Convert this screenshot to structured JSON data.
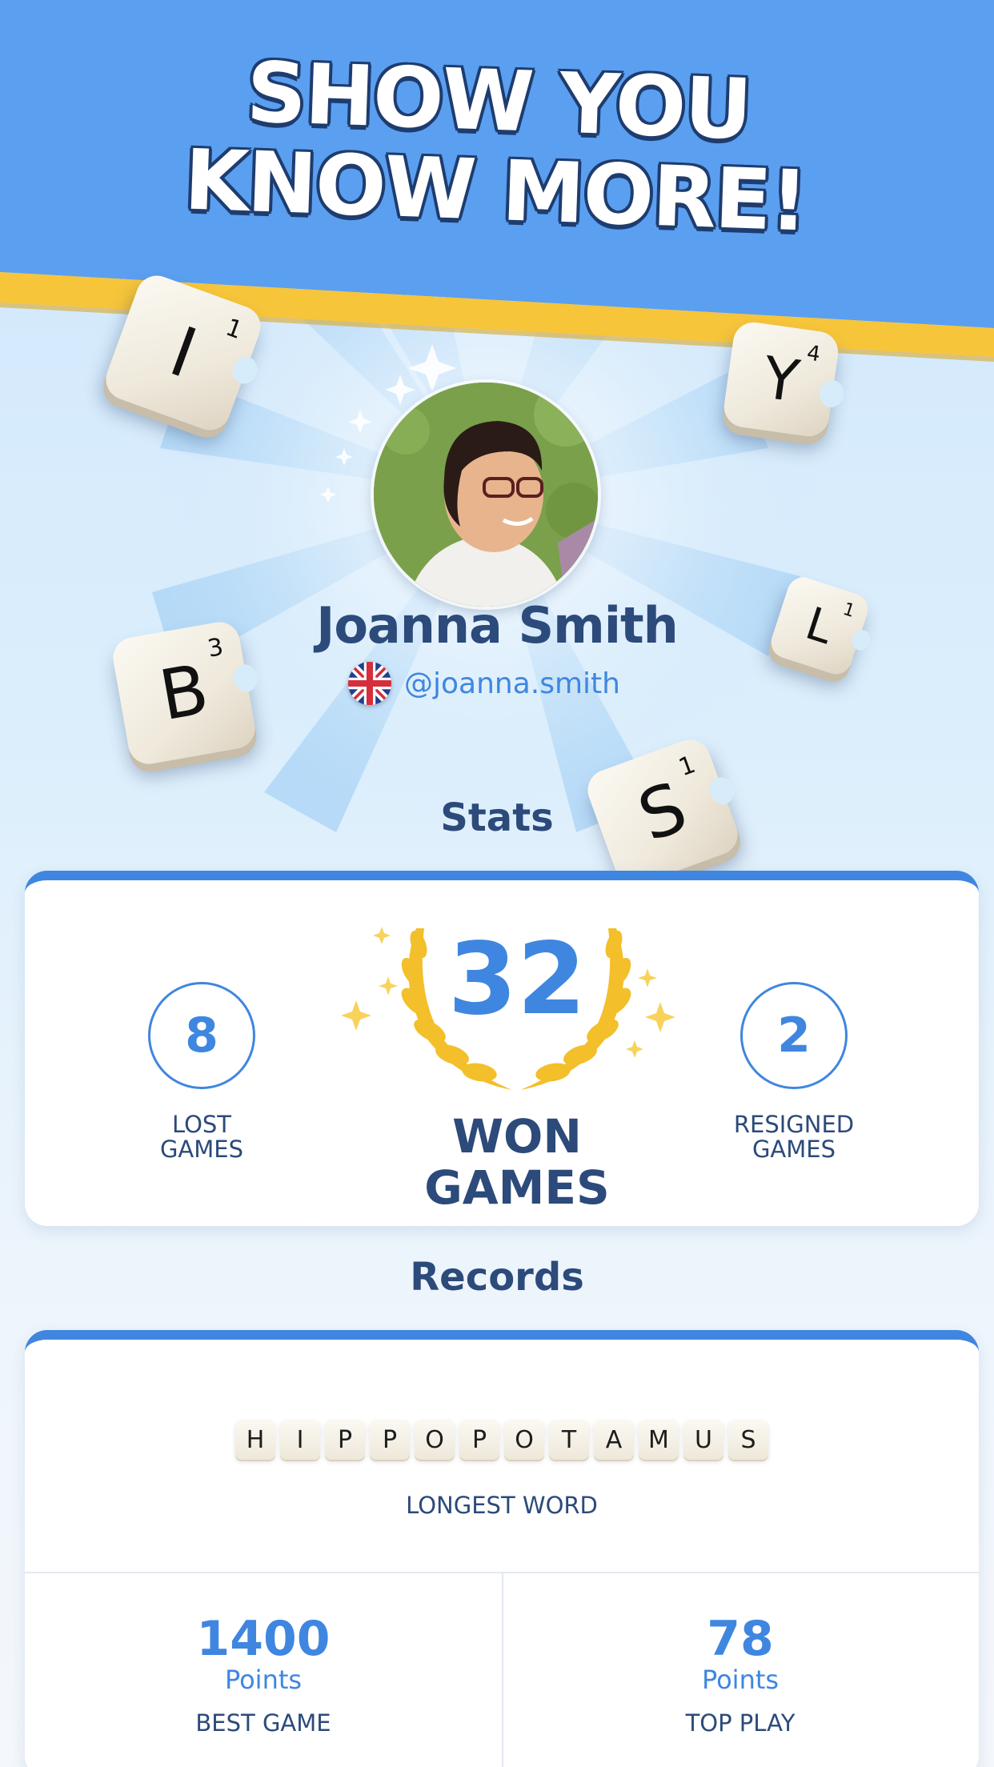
{
  "promo": {
    "headline_line1": "SHOW YOU",
    "headline_line2": "KNOW MORE!"
  },
  "colors": {
    "banner_blue": "#5b9ff0",
    "stripe_yellow": "#f6c53a",
    "accent_blue": "#3f86e0",
    "dark_navy": "#2c4a7a"
  },
  "decor_tiles": [
    {
      "letter": "I",
      "score": "1"
    },
    {
      "letter": "Y",
      "score": "4"
    },
    {
      "letter": "L",
      "score": "1"
    },
    {
      "letter": "B",
      "score": "3"
    },
    {
      "letter": "S",
      "score": "1"
    }
  ],
  "profile": {
    "avatar_icon": "profile-photo",
    "name": "Joanna Smith",
    "flag_icon": "uk-flag-icon",
    "handle": "@joanna.smith"
  },
  "stats": {
    "title": "Stats",
    "lost": {
      "value": "8",
      "label_line1": "LOST",
      "label_line2": "GAMES"
    },
    "won": {
      "value": "32",
      "label_line1": "WON",
      "label_line2": "GAMES"
    },
    "resigned": {
      "value": "2",
      "label_line1": "RESIGNED",
      "label_line2": "GAMES"
    }
  },
  "records": {
    "title": "Records",
    "longest_word_letters": [
      "H",
      "I",
      "P",
      "P",
      "O",
      "P",
      "O",
      "T",
      "A",
      "M",
      "U",
      "S"
    ],
    "longest_word_label": "LONGEST WORD",
    "best_game": {
      "value": "1400",
      "unit": "Points",
      "label": "BEST GAME"
    },
    "top_play": {
      "value": "78",
      "unit": "Points",
      "label": "TOP PLAY"
    }
  }
}
